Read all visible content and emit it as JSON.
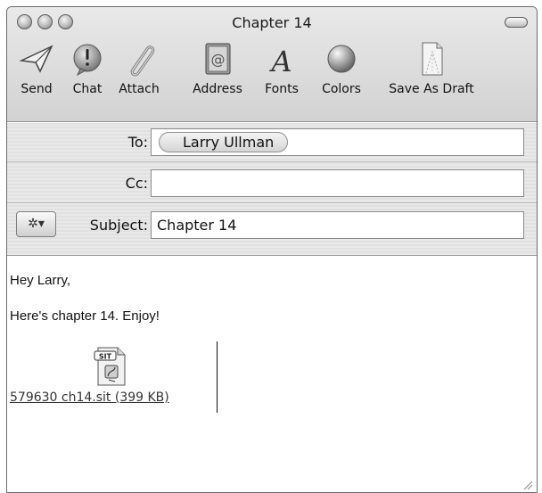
{
  "window": {
    "title": "Chapter 14"
  },
  "toolbar": {
    "items": [
      {
        "label": "Send",
        "icon": "send-icon"
      },
      {
        "label": "Chat",
        "icon": "chat-icon"
      },
      {
        "label": "Attach",
        "icon": "paperclip-icon"
      },
      {
        "label": "Address",
        "icon": "address-book-icon"
      },
      {
        "label": "Fonts",
        "icon": "fonts-icon"
      },
      {
        "label": "Colors",
        "icon": "colors-icon"
      },
      {
        "label": "Save As Draft",
        "icon": "draft-icon"
      }
    ]
  },
  "headers": {
    "to_label": "To:",
    "to_recipient": "Larry Ullman",
    "cc_label": "Cc:",
    "cc_value": "",
    "subject_label": "Subject:",
    "subject_value": "Chapter 14",
    "action_glyph": "✲▾"
  },
  "message": {
    "greeting": "Hey Larry,",
    "text": "Here's chapter 14. Enjoy!",
    "attachment": {
      "icon_label": "SIT",
      "name": "579630 ch14.sit (399 KB)"
    }
  },
  "colors": {
    "chrome": "#d8d8d8",
    "field_border": "#8a8a8a"
  }
}
